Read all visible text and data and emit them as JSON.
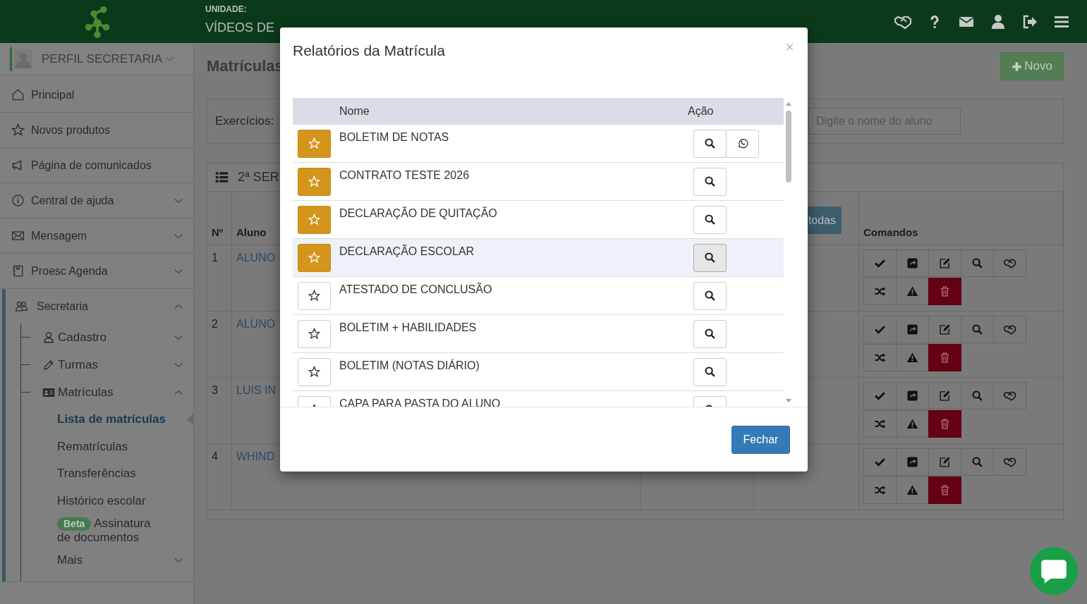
{
  "header": {
    "unit_label": "UNIDADE:",
    "unit_name": "VÍDEOS DE"
  },
  "sidebar": {
    "profile": "PERFIL SECRETARIA",
    "items": [
      {
        "label": "Principal"
      },
      {
        "label": "Novos produtos"
      },
      {
        "label": "Página de comunicados"
      },
      {
        "label": "Central de ajuda",
        "expanded": false
      },
      {
        "label": "Mensagem",
        "expanded": false
      },
      {
        "label": "Proesc Agenda",
        "expanded": false
      },
      {
        "label": "Secretaria",
        "expanded": true,
        "children": [
          {
            "label": "Cadastro",
            "expanded": false
          },
          {
            "label": "Turmas",
            "expanded": false
          },
          {
            "label": "Matrículas",
            "expanded": true,
            "children": [
              {
                "label": "Lista de matrículas",
                "selected": true
              },
              {
                "label": "Rematrículas",
                "selected": false
              },
              {
                "label": "Transferências",
                "selected": false
              },
              {
                "label": "Histórico escolar",
                "selected": false
              },
              {
                "label": "Assinatura de documentos",
                "badge": "Beta",
                "selected": false
              },
              {
                "label": "Mais",
                "expanded": false,
                "selected": false
              }
            ]
          }
        ]
      }
    ]
  },
  "content": {
    "title": "Matrículas",
    "new_button": "Novo",
    "filter": {
      "label": "Exercícios:",
      "search_placeholder": "Digite o nome do aluno"
    },
    "class_panel": {
      "title": "2ª SER",
      "filter_button": "todas",
      "columns": [
        "Nº",
        "Aluno",
        "Comandos"
      ],
      "rows": [
        {
          "number": "1",
          "student": "ALUNO"
        },
        {
          "number": "2",
          "student": "ALUNO"
        },
        {
          "number": "3",
          "student": "LUIS IN"
        },
        {
          "number": "4",
          "student": "WHIND"
        }
      ]
    }
  },
  "modal": {
    "title": "Relatórios da Matrícula",
    "close": "×",
    "columns": [
      "Nome",
      "Ação"
    ],
    "reports": [
      {
        "name": "BOLETIM DE NOTAS",
        "favorite": true,
        "whatsapp": true,
        "highlighted": false
      },
      {
        "name": "CONTRATO TESTE 2026",
        "favorite": true,
        "whatsapp": false,
        "highlighted": false
      },
      {
        "name": "DECLARAÇÃO DE QUITAÇÃO",
        "favorite": true,
        "whatsapp": false,
        "highlighted": false
      },
      {
        "name": "DECLARAÇÃO ESCOLAR",
        "favorite": true,
        "whatsapp": false,
        "highlighted": true
      },
      {
        "name": "ATESTADO DE CONCLUSÃO",
        "favorite": false,
        "whatsapp": false,
        "highlighted": false
      },
      {
        "name": "BOLETIM + HABILIDADES",
        "favorite": false,
        "whatsapp": false,
        "highlighted": false
      },
      {
        "name": "BOLETIM (NOTAS DIÁRIO)",
        "favorite": false,
        "whatsapp": false,
        "highlighted": false
      },
      {
        "name": "CAPA PARA PASTA DO ALUNO",
        "favorite": false,
        "whatsapp": false,
        "highlighted": false
      }
    ],
    "close_button": "Fechar"
  }
}
